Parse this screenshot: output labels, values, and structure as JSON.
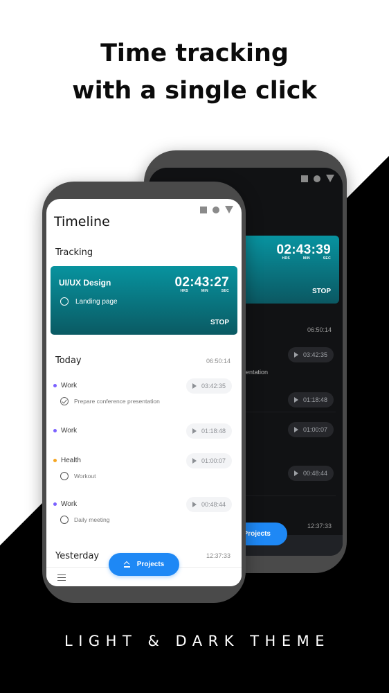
{
  "headline": {
    "line1": "Time tracking",
    "line2": "with a single click"
  },
  "footer_caption": "LIGHT & DARK THEME",
  "colors": {
    "accent": "#1e88f5",
    "card_top": "#08939f",
    "card_bottom": "#0a5a63",
    "work_dot": "#7b61ff",
    "health_dot": "#f5a623"
  },
  "dark_phone": {
    "status_icons": [
      "square-icon",
      "circle-icon",
      "triangle-icon"
    ],
    "tracking_card": {
      "timer": "02:43:39",
      "units": [
        "HRS",
        "MIN",
        "SEC"
      ],
      "stop_label": "STOP"
    },
    "today_total": "06:50:14",
    "partial_task_text": "entation",
    "entries": [
      {
        "duration": "03:42:35"
      },
      {
        "duration": "01:18:48"
      },
      {
        "duration": "01:00:07"
      },
      {
        "duration": "00:48:44"
      }
    ],
    "yesterday_total": "12:37:33",
    "projects_label": "Projects"
  },
  "light_phone": {
    "status_icons": [
      "square-icon",
      "circle-icon",
      "triangle-icon"
    ],
    "title": "Timeline",
    "tracking_label": "Tracking",
    "tracking_card": {
      "project": "UI/UX Design",
      "task": "Landing page",
      "timer": "02:43:27",
      "units": [
        "HRS",
        "MIN",
        "SEC"
      ],
      "stop_label": "STOP"
    },
    "today": {
      "label": "Today",
      "total": "06:50:14",
      "entries": [
        {
          "project": "Work",
          "task": "Prepare conference presentation",
          "task_status": "done",
          "duration": "03:42:35"
        },
        {
          "project": "Work",
          "task": "",
          "duration": "01:18:48"
        },
        {
          "project": "Health",
          "task": "Workout",
          "task_status": "open",
          "duration": "01:00:07"
        },
        {
          "project": "Work",
          "task": "Daily meeting",
          "task_status": "open",
          "duration": "00:48:44"
        }
      ]
    },
    "yesterday": {
      "label": "Yesterday",
      "total": "12:37:33"
    },
    "projects_label": "Projects"
  }
}
